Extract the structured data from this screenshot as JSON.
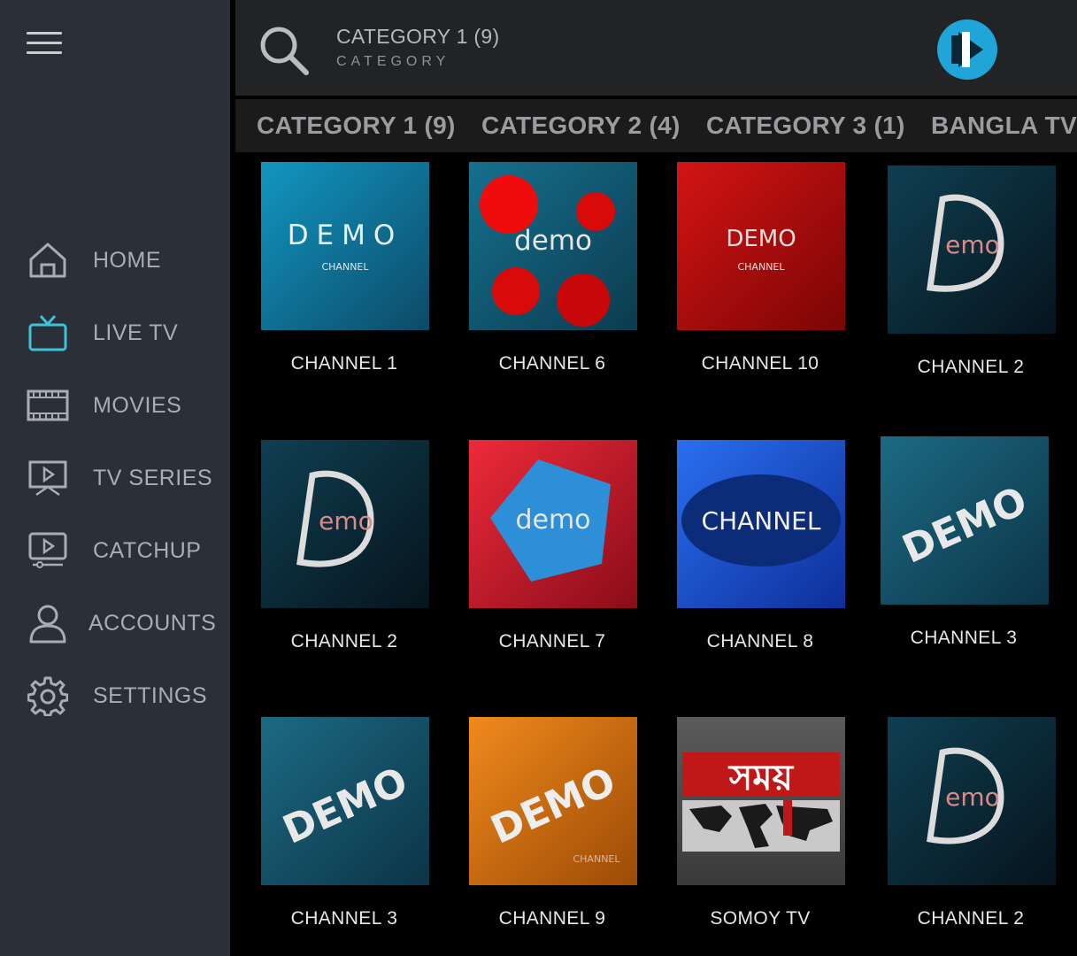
{
  "sidebar": {
    "items": [
      {
        "label": "HOME",
        "icon": "home-icon"
      },
      {
        "label": "LIVE TV",
        "icon": "tv-icon"
      },
      {
        "label": "MOVIES",
        "icon": "film-icon"
      },
      {
        "label": "TV SERIES",
        "icon": "series-icon"
      },
      {
        "label": "CATCHUP",
        "icon": "catchup-icon"
      },
      {
        "label": "ACCOUNTS",
        "icon": "user-icon"
      },
      {
        "label": "SETTINGS",
        "icon": "gear-icon"
      }
    ],
    "active_color": "#3fc3d8"
  },
  "header": {
    "title": "CATEGORY 1 (9)",
    "subtitle": "CATEGORY"
  },
  "tabs": [
    {
      "label": "CATEGORY 1 (9)"
    },
    {
      "label": "CATEGORY 2 (4)"
    },
    {
      "label": "CATEGORY 3 (1)"
    },
    {
      "label": "BANGLA TV"
    }
  ],
  "channels": [
    {
      "name": "CHANNEL 1",
      "logo_text": "DEMO",
      "logo_sub": "CHANNEL"
    },
    {
      "name": "CHANNEL 6",
      "logo_text": "demo"
    },
    {
      "name": "CHANNEL 10",
      "logo_text": "DEMO",
      "logo_sub": "CHANNEL"
    },
    {
      "name": "CHANNEL 2",
      "logo_text": "emo"
    },
    {
      "name": "CHANNEL 2",
      "logo_text": "emo"
    },
    {
      "name": "CHANNEL 7",
      "logo_text": "demo"
    },
    {
      "name": "CHANNEL 8",
      "logo_text": "CHANNEL"
    },
    {
      "name": "CHANNEL 3",
      "logo_text": "DEMO"
    },
    {
      "name": "CHANNEL 3",
      "logo_text": "DEMO"
    },
    {
      "name": "CHANNEL 9",
      "logo_text": "DEMO",
      "logo_sub": "CHANNEL"
    },
    {
      "name": "SOMOY TV",
      "logo_text": "সময়"
    },
    {
      "name": "CHANNEL 2",
      "logo_text": "emo"
    }
  ]
}
